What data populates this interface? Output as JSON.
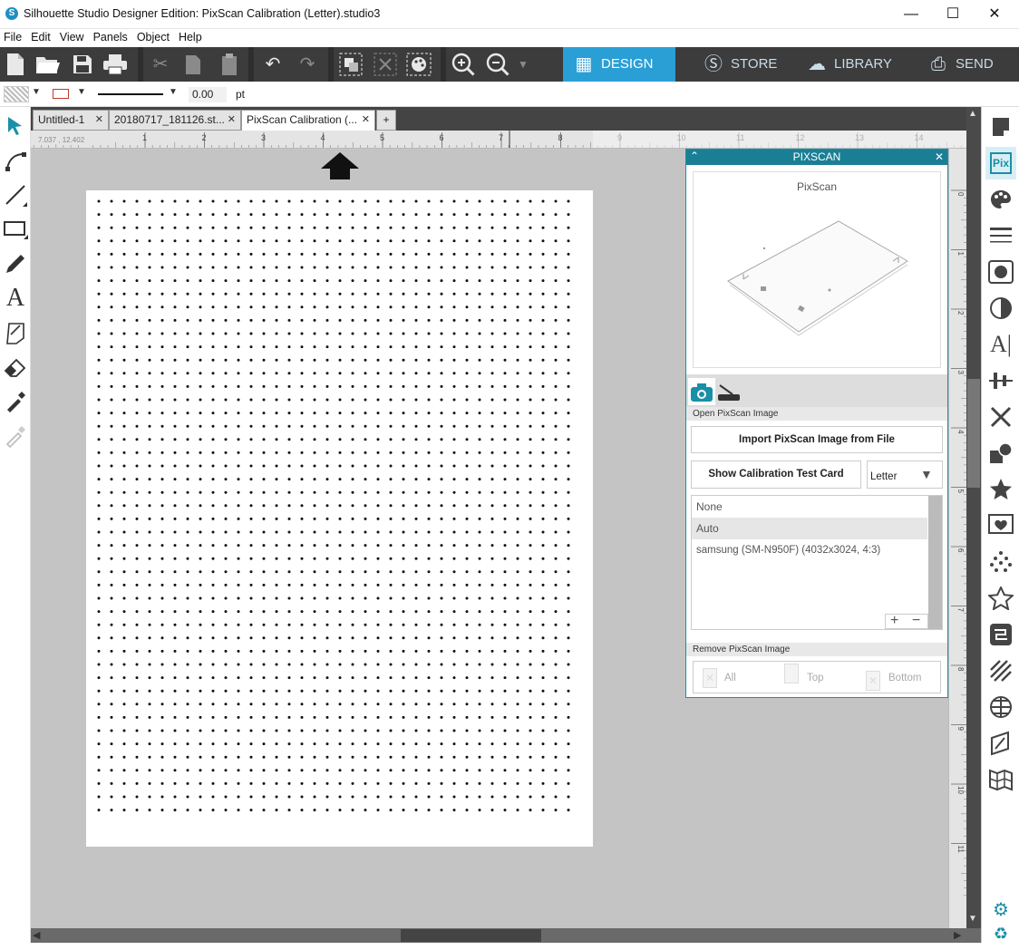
{
  "window": {
    "title": "Silhouette Studio Designer Edition: PixScan Calibration (Letter).studio3",
    "minimize_label": "—",
    "maximize_label": "☐",
    "close_label": "✕"
  },
  "menu": [
    "File",
    "Edit",
    "View",
    "Panels",
    "Object",
    "Help"
  ],
  "nav_tabs": [
    {
      "label": "DESIGN",
      "active": true
    },
    {
      "label": "STORE",
      "active": false
    },
    {
      "label": "LIBRARY",
      "active": false
    },
    {
      "label": "SEND",
      "active": false
    }
  ],
  "propbar": {
    "line_width_value": "0.00",
    "line_width_unit": "pt"
  },
  "doc_tabs": [
    {
      "label": "Untitled-1"
    },
    {
      "label": "20180717_181126.st..."
    },
    {
      "label": "PixScan Calibration (..."
    }
  ],
  "add_tab_label": "+",
  "ruler": {
    "coords": "7.037 , 12.402",
    "h_ticks": [
      "1",
      "2",
      "3",
      "4",
      "5",
      "6",
      "7",
      "8",
      "9",
      "10",
      "11",
      "12",
      "13",
      "14"
    ],
    "v_ticks": [
      "0",
      "1",
      "2",
      "3",
      "4",
      "5",
      "6",
      "7",
      "8",
      "9",
      "10",
      "11"
    ]
  },
  "panel": {
    "title": "PIXSCAN",
    "preview_label": "PixScan",
    "open_section_label": "Open PixScan Image",
    "import_button": "Import PixScan Image from File",
    "calibration_button": "Show Calibration Test Card",
    "paper_size": "Letter",
    "camera_list": [
      "None",
      "Auto",
      "samsung (SM-N950F) (4032x3024, 4:3)"
    ],
    "selected_camera_index": 1,
    "add_label": "+",
    "remove_label": "−",
    "remove_section_label": "Remove PixScan Image",
    "remove_all": "All",
    "remove_top": "Top",
    "remove_bottom": "Bottom"
  },
  "colors": {
    "accent": "#2a9fd6",
    "toolbar_bg": "#3c3c3c",
    "canvas_bg": "#c4c4c4",
    "panel_header": "#1a7f95"
  }
}
